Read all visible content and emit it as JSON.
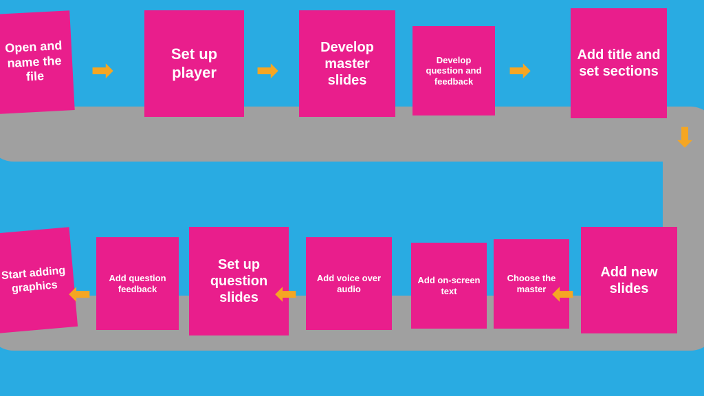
{
  "roads": {
    "top_color": "#a0a0a0",
    "bottom_color": "#a0a0a0"
  },
  "top_row": {
    "cards": [
      {
        "id": "card-open",
        "label": "Open and name the file",
        "font_size": "15px"
      },
      {
        "id": "card-setup",
        "label": "Set up player",
        "font_size": "22px"
      },
      {
        "id": "card-develop-master",
        "label": "Develop master slides",
        "font_size": "20px"
      },
      {
        "id": "card-develop-question",
        "label": "Develop question and feedback",
        "font_size": "13px"
      },
      {
        "id": "card-add-title",
        "label": "Add title and set sections",
        "font_size": "20px"
      }
    ],
    "arrows": [
      {
        "id": "arrow-1",
        "symbol": "➡"
      },
      {
        "id": "arrow-2",
        "symbol": "➡"
      },
      {
        "id": "arrow-3",
        "symbol": "➡"
      },
      {
        "id": "arrow-down",
        "symbol": "⬇"
      }
    ]
  },
  "bottom_row": {
    "cards": [
      {
        "id": "card-start",
        "label": "Start adding graphics",
        "font_size": "16px"
      },
      {
        "id": "card-add-feedback",
        "label": "Add question feedback",
        "font_size": "13px"
      },
      {
        "id": "card-setup-question",
        "label": "Set up question slides",
        "font_size": "20px"
      },
      {
        "id": "card-add-voice",
        "label": "Add voice over audio",
        "font_size": "13px"
      },
      {
        "id": "card-add-onscreen",
        "label": "Add on-screen text",
        "font_size": "13px"
      },
      {
        "id": "card-choose-master",
        "label": "Choose the master",
        "font_size": "13px"
      },
      {
        "id": "card-add-new",
        "label": "Add new slides",
        "font_size": "20px"
      }
    ],
    "arrows": [
      {
        "id": "arrow-b1",
        "symbol": "⬅"
      },
      {
        "id": "arrow-b2",
        "symbol": "⬅"
      },
      {
        "id": "arrow-b3",
        "symbol": "⬅"
      }
    ]
  }
}
